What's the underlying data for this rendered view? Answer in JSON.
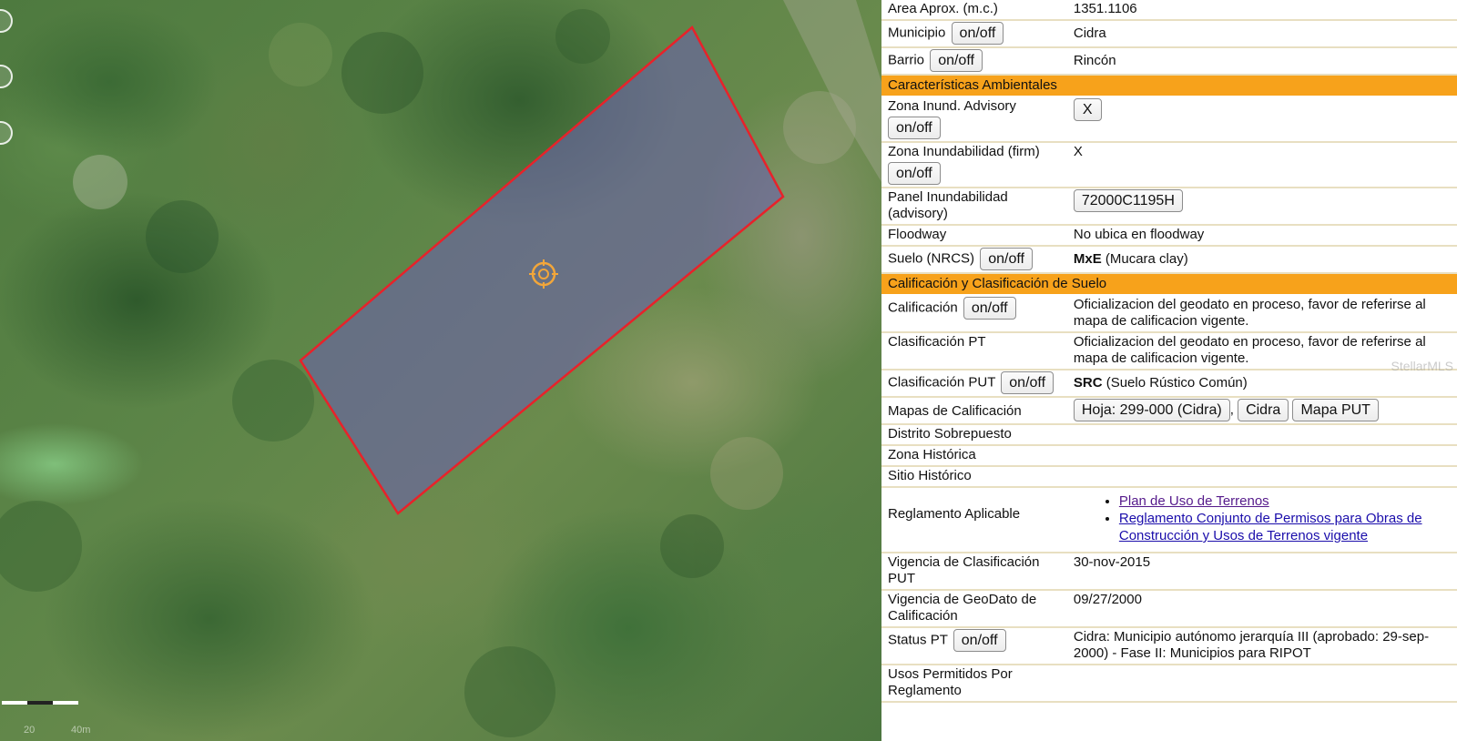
{
  "map": {
    "parcel_outline_color": "#e8222a",
    "parcel_fill_color": "#6b63a8",
    "scale_labels": [
      "20",
      "40m"
    ]
  },
  "info": {
    "area": {
      "label": "Area Aprox. (m.c.)",
      "value": "1351.1106"
    },
    "municipio": {
      "label": "Municipio",
      "button": "on/off",
      "value": "Cidra"
    },
    "barrio": {
      "label": "Barrio",
      "button": "on/off",
      "value": "Rincón"
    },
    "section_ambientales": "Características Ambientales",
    "zona_advisory": {
      "label": "Zona Inund. Advisory",
      "button": "on/off",
      "value_button": "X"
    },
    "zona_firm": {
      "label": "Zona Inundabilidad (firm)",
      "button": "on/off",
      "value": "X"
    },
    "panel": {
      "label": "Panel Inundabilidad (advisory)",
      "value_button": "72000C1195H"
    },
    "floodway": {
      "label": "Floodway",
      "value": "No ubica en floodway"
    },
    "suelo": {
      "label": "Suelo (NRCS)",
      "button": "on/off",
      "value_bold": "MxE",
      "value": " (Mucara clay)"
    },
    "section_calificacion": "Calificación y Clasificación de Suelo",
    "calificacion": {
      "label": "Calificación",
      "button": "on/off",
      "value": "Oficializacion del geodato en proceso, favor de referirse al mapa de calificacion vigente."
    },
    "clasificacion_pt": {
      "label": "Clasificación PT",
      "value": "Oficializacion del geodato en proceso, favor de referirse al mapa de calificacion vigente."
    },
    "clasificacion_put": {
      "label": "Clasificación PUT",
      "button": "on/off",
      "value_bold": "SRC",
      "value": " (Suelo Rústico Común)"
    },
    "mapas": {
      "label": "Mapas de Calificación",
      "buttons": [
        "Hoja: 299-000 (Cidra)",
        "Cidra",
        "Mapa PUT"
      ],
      "separator": ","
    },
    "distrito": {
      "label": "Distrito Sobrepuesto",
      "value": ""
    },
    "zona_historica": {
      "label": "Zona Histórica",
      "value": ""
    },
    "sitio_historico": {
      "label": "Sitio Histórico",
      "value": ""
    },
    "reglamento": {
      "label": "Reglamento Aplicable",
      "links": [
        "Plan de Uso de Terrenos",
        "Reglamento Conjunto de Permisos para Obras de Construcción y Usos de Terrenos vigente"
      ]
    },
    "vigencia_put": {
      "label": "Vigencia de Clasificación PUT",
      "value": "30-nov-2015"
    },
    "vigencia_geodato": {
      "label": "Vigencia de GeoDato de Calificación",
      "value": "09/27/2000"
    },
    "status_pt": {
      "label": "Status PT",
      "button": "on/off",
      "value": "Cidra: Municipio autónomo jerarquía III (aprobado: 29-sep-2000) - Fase II: Municipios para RIPOT"
    },
    "usos": {
      "label": "Usos Permitidos Por Reglamento",
      "value": ""
    },
    "watermark": "StellarMLS"
  }
}
